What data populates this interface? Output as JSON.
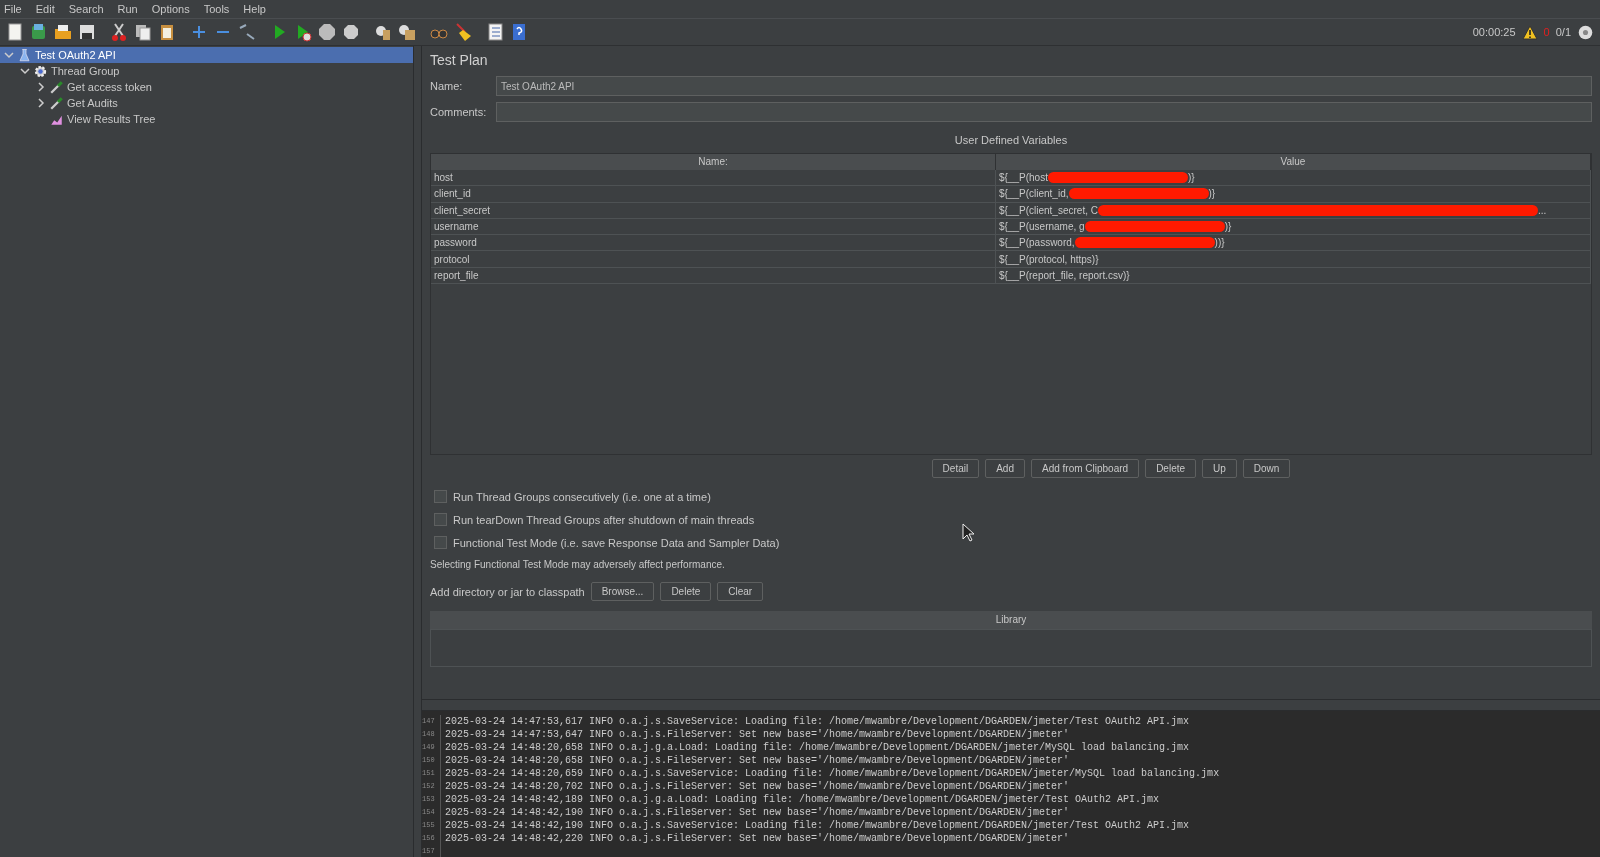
{
  "menu": [
    "File",
    "Edit",
    "Search",
    "Run",
    "Options",
    "Tools",
    "Help"
  ],
  "status": {
    "timer": "00:00:25",
    "errors": "0",
    "threads": "0/1"
  },
  "tree": [
    {
      "label": "Test OAuth2 API",
      "kind": "plan",
      "selected": true,
      "expanded": true,
      "children": [
        {
          "label": "Thread Group",
          "kind": "group",
          "selected": false,
          "expanded": true,
          "children": [
            {
              "label": "Get access token",
              "kind": "sampler",
              "selected": false,
              "expanded": false
            },
            {
              "label": "Get Audits",
              "kind": "sampler",
              "selected": false,
              "expanded": false
            },
            {
              "label": "View Results Tree",
              "kind": "listener",
              "selected": false
            }
          ]
        }
      ]
    }
  ],
  "panel": {
    "title": "Test Plan",
    "name_label": "Name:",
    "name_value": "Test OAuth2 API",
    "comments_label": "Comments:",
    "variables_title": "User Defined Variables"
  },
  "table": {
    "columns": [
      "Name:",
      "Value"
    ],
    "rows": [
      {
        "name": "host",
        "value": "${__P(host",
        "redacted": true,
        "value_end": ")}"
      },
      {
        "name": "client_id",
        "value": "${__P(client_id,",
        "redacted": true,
        "value_end": ")}"
      },
      {
        "name": "client_secret",
        "value": "${__P(client_secret, C",
        "redacted": true,
        "value_end": "..."
      },
      {
        "name": "username",
        "value": "${__P(username, g",
        "redacted": true,
        "value_end": ")}"
      },
      {
        "name": "password",
        "value": "${__P(password,",
        "redacted": true,
        "value_end": "))}"
      },
      {
        "name": "protocol",
        "value": "${__P(protocol, https)}",
        "redacted": false
      },
      {
        "name": "report_file",
        "value": "${__P(report_file, report.csv)}",
        "redacted": false
      }
    ]
  },
  "table_buttons": [
    "Detail",
    "Add",
    "Add from Clipboard",
    "Delete",
    "Up",
    "Down"
  ],
  "options": [
    {
      "label": "Run Thread Groups consecutively (i.e. one at a time)",
      "checked": false
    },
    {
      "label": "Run tearDown Thread Groups after shutdown of main threads",
      "checked": false
    },
    {
      "label": "Functional Test Mode (i.e. save Response Data and Sampler Data)",
      "checked": false
    }
  ],
  "note": "Selecting Functional Test Mode may adversely affect performance.",
  "classpath": {
    "label": "Add directory or jar to classpath",
    "buttons": [
      "Browse...",
      "Delete",
      "Clear"
    ],
    "library_header": "Library"
  },
  "log": [
    {
      "line": "147",
      "text": "2025-03-24 14:47:53,617 INFO o.a.j.s.SaveService: Loading file: /home/mwambre/Development/DGARDEN/jmeter/Test OAuth2 API.jmx"
    },
    {
      "line": "148",
      "text": "2025-03-24 14:47:53,647 INFO o.a.j.s.FileServer: Set new base='/home/mwambre/Development/DGARDEN/jmeter'"
    },
    {
      "line": "149",
      "text": "2025-03-24 14:48:20,658 INFO o.a.j.g.a.Load: Loading file: /home/mwambre/Development/DGARDEN/jmeter/MySQL load balancing.jmx"
    },
    {
      "line": "150",
      "text": "2025-03-24 14:48:20,658 INFO o.a.j.s.FileServer: Set new base='/home/mwambre/Development/DGARDEN/jmeter'"
    },
    {
      "line": "151",
      "text": "2025-03-24 14:48:20,659 INFO o.a.j.s.SaveService: Loading file: /home/mwambre/Development/DGARDEN/jmeter/MySQL load balancing.jmx"
    },
    {
      "line": "152",
      "text": "2025-03-24 14:48:20,702 INFO o.a.j.s.FileServer: Set new base='/home/mwambre/Development/DGARDEN/jmeter'"
    },
    {
      "line": "153",
      "text": "2025-03-24 14:48:42,189 INFO o.a.j.g.a.Load: Loading file: /home/mwambre/Development/DGARDEN/jmeter/Test OAuth2 API.jmx"
    },
    {
      "line": "154",
      "text": "2025-03-24 14:48:42,190 INFO o.a.j.s.FileServer: Set new base='/home/mwambre/Development/DGARDEN/jmeter'"
    },
    {
      "line": "155",
      "text": "2025-03-24 14:48:42,190 INFO o.a.j.s.SaveService: Loading file: /home/mwambre/Development/DGARDEN/jmeter/Test OAuth2 API.jmx"
    },
    {
      "line": "156",
      "text": "2025-03-24 14:48:42,220 INFO o.a.j.s.FileServer: Set new base='/home/mwambre/Development/DGARDEN/jmeter'"
    },
    {
      "line": "157"
    }
  ]
}
